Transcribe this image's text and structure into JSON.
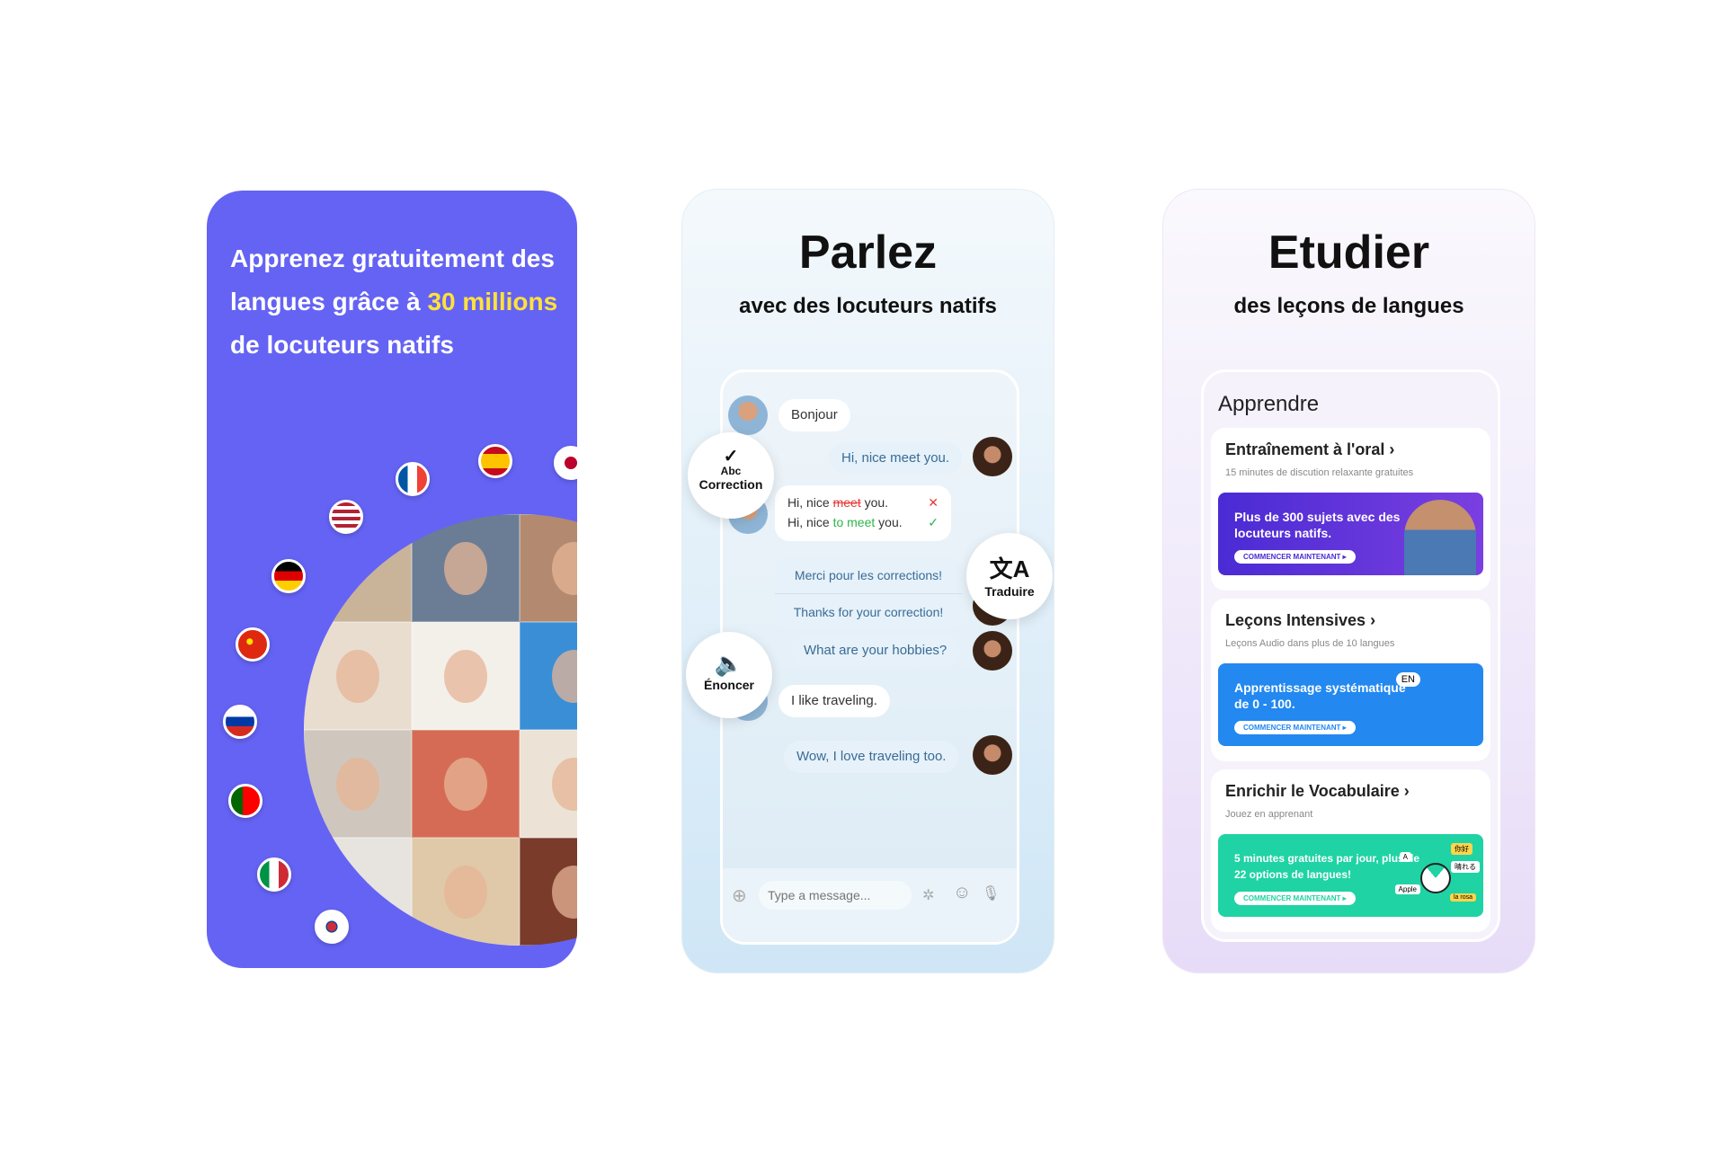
{
  "panel1": {
    "headline_pre": "Apprenez gratuitement des langues grâce à ",
    "headline_highlight": "30 millions",
    "headline_post": " de locuteurs natifs",
    "bg_color": "#6563f4",
    "highlight_color": "#ffe23a"
  },
  "panel2": {
    "title": "Parlez",
    "subtitle": "avec des locuteurs natifs",
    "messages": {
      "m1": "Bonjour",
      "m2": "Hi, nice meet you.",
      "c1a": "Hi, nice ",
      "c1b": "meet",
      "c1c": " you.",
      "c2a": "Hi, nice ",
      "c2b": "to meet",
      "c2c": " you.",
      "m3": "Merci pour les corrections!",
      "m3t": "Thanks for your correction!",
      "m4": "What are your hobbies?",
      "m5": "I like traveling.",
      "m6": "Wow, I love traveling too."
    },
    "badges": {
      "correction_icon": "Abc",
      "correction": "Correction",
      "translate": "Traduire",
      "speak": "Énoncer"
    },
    "input_placeholder": "Type a message..."
  },
  "panel3": {
    "title": "Etudier",
    "subtitle": "des leçons de langues",
    "card_title": "Apprendre",
    "sections": [
      {
        "title": "Entraînement à l'oral",
        "desc": "15 minutes de discution relaxante gratuites",
        "banner": "Plus de 300 sujets avec des locuteurs natifs.",
        "cta": "COMMENCER MAINTENANT ▸",
        "color": "#5a2fd8"
      },
      {
        "title": "Leçons Intensives",
        "desc": "Leçons Audio dans plus de 10 langues",
        "banner": "Apprentissage systématique de 0 - 100.",
        "cta": "COMMENCER MAINTENANT ▸",
        "color": "#2388f0",
        "tag": "EN"
      },
      {
        "title": "Enrichir le Vocabulaire",
        "desc": "Jouez en apprenant",
        "banner": "5 minutes gratuites par jour, plus de 22 options de langues!",
        "cta": "COMMENCER MAINTENANT ▸",
        "color": "#1fd3a4",
        "tags": [
          "你好",
          "晴れる",
          "Apple",
          "la rosa",
          "A"
        ]
      }
    ]
  }
}
